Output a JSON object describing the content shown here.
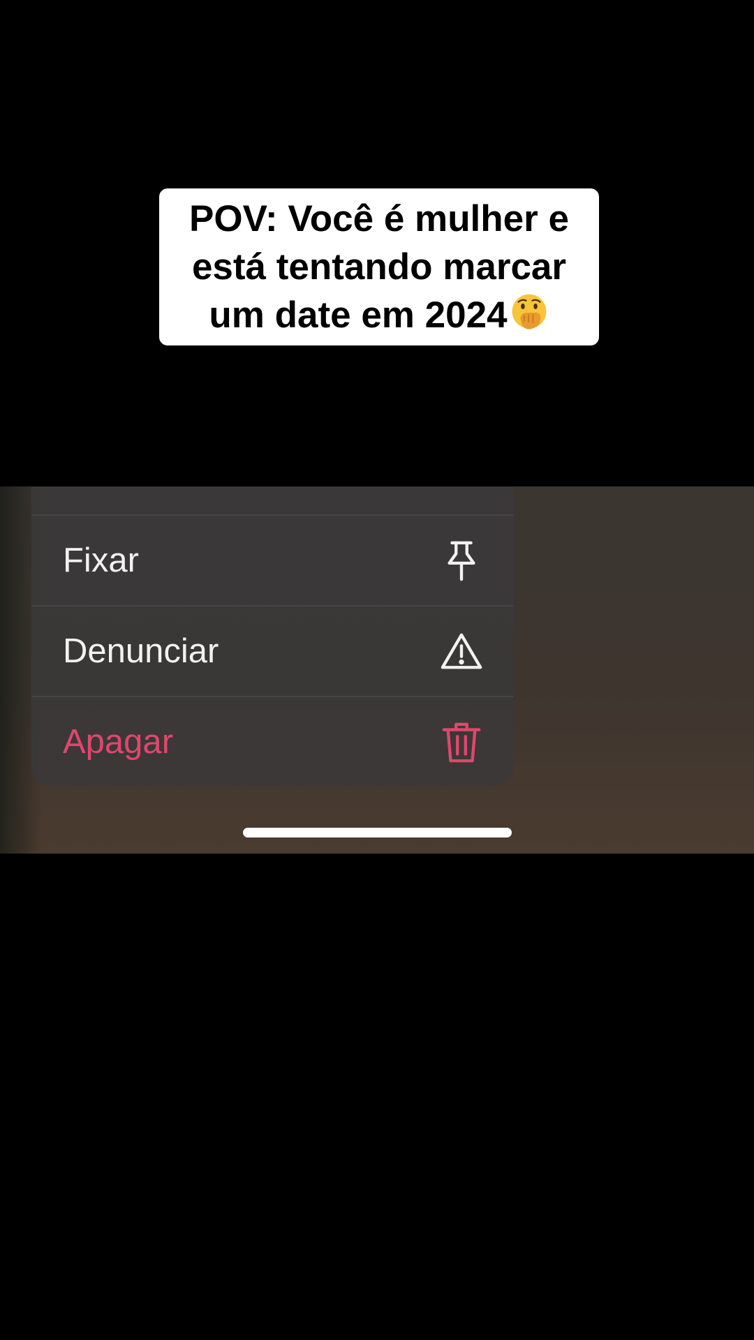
{
  "caption": {
    "lines": [
      "POV: Você é mulher e",
      "está tentando marcar",
      "um date em 2024"
    ],
    "emoji": "face-with-hand-over-mouth"
  },
  "context_menu": {
    "items": [
      {
        "label": "Fixar",
        "icon": "pin-icon",
        "destructive": false
      },
      {
        "label": "Denunciar",
        "icon": "warning-triangle-icon",
        "destructive": false
      },
      {
        "label": "Apagar",
        "icon": "trash-icon",
        "destructive": true
      }
    ]
  },
  "colors": {
    "destructive": "#e0476c",
    "menu_text": "#f2f2f2",
    "caption_bg": "#ffffff",
    "page_bg": "#000000"
  }
}
